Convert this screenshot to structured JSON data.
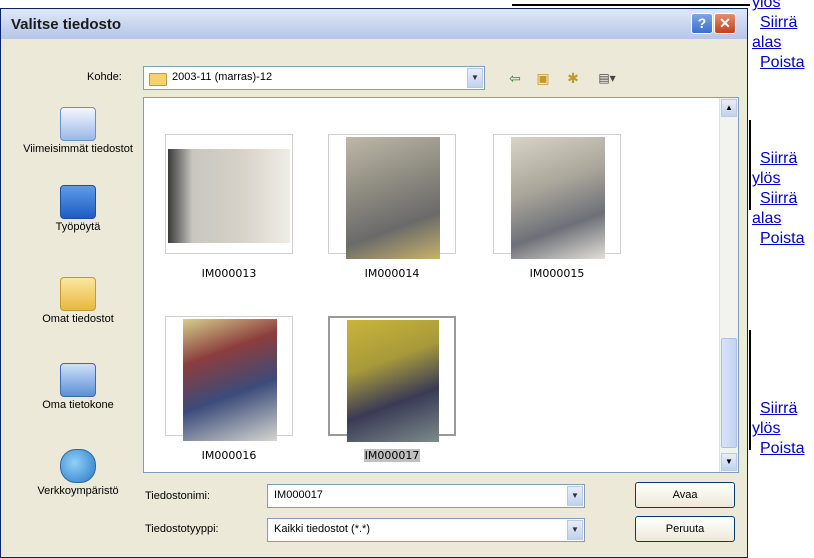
{
  "dialog": {
    "title": "Valitse tiedosto",
    "help_label": "?",
    "close_label": "✕",
    "look_in_label": "Kohde:",
    "look_in_value": "2003-11 (marras)-12",
    "toolbar_icons": [
      "back-icon",
      "up-folder-icon",
      "new-folder-icon",
      "view-menu-icon"
    ]
  },
  "places": [
    {
      "label": "Viimeisimmät tiedostot",
      "icon": "recent-documents-icon"
    },
    {
      "label": "Työpöytä",
      "icon": "desktop-icon"
    },
    {
      "label": "Omat tiedostot",
      "icon": "my-documents-icon"
    },
    {
      "label": "Oma tietokone",
      "icon": "my-computer-icon"
    },
    {
      "label": "Verkkoympäristö",
      "icon": "network-places-icon"
    }
  ],
  "files": [
    {
      "name": "IM000013"
    },
    {
      "name": "IM000014"
    },
    {
      "name": "IM000015"
    },
    {
      "name": "IM000016"
    },
    {
      "name": "IM000017",
      "selected": true
    }
  ],
  "footer": {
    "filename_label": "Tiedostonimi:",
    "filename_value": "IM000017",
    "filetype_label": "Tiedostotyyppi:",
    "filetype_value": "Kaikki tiedostot (*.*)",
    "open_label": "Avaa",
    "cancel_label": "Peruuta"
  },
  "background_links": [
    {
      "up": "ylös",
      "move": "Siirrä",
      "down": "alas",
      "delete": "Poista"
    },
    {
      "move_up": "Siirrä",
      "up": "ylös",
      "move": "Siirrä",
      "down": "alas",
      "delete": "Poista"
    },
    {
      "move": "Siirrä",
      "up": "ylös",
      "delete": "Poista"
    }
  ]
}
